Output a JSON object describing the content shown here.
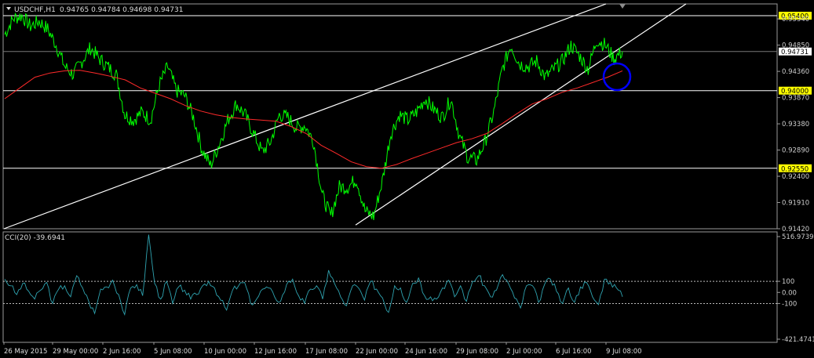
{
  "header": {
    "symbol": "USDCHF,H1",
    "ohlc": "0.94765 0.94784 0.94698 0.94731"
  },
  "indicator": {
    "label": "CCI(20) -39.6941"
  },
  "colors": {
    "background": "#000000",
    "price": "#00ff00",
    "ma": "#ff2a2a",
    "cci": "#2fa3b0",
    "hline": "#ffffff",
    "level_label_bg": "#ffff00",
    "marker": "#0000ff"
  },
  "chart_data": [
    {
      "type": "line",
      "title": "USDCHF,H1",
      "y_ticks": [
        "0.95340",
        "0.94850",
        "0.94360",
        "0.93870",
        "0.93380",
        "0.92890",
        "0.92400",
        "0.91910",
        "0.91420"
      ],
      "ylim": [
        0.9142,
        0.9562
      ],
      "current_price": "0.94731",
      "horizontal_levels": [
        {
          "value": 0.954,
          "label": "0.95400"
        },
        {
          "value": 0.94,
          "label": "0.94000"
        },
        {
          "value": 0.9255,
          "label": "0.92550"
        }
      ],
      "x_ticks": [
        "26 May 2015",
        "29 May 00:00",
        "2 Jun 16:00",
        "5 Jun 08:00",
        "10 Jun 00:00",
        "12 Jun 16:00",
        "17 Jun 08:00",
        "22 Jun 00:00",
        "24 Jun 16:00",
        "29 Jun 08:00",
        "2 Jul 00:00",
        "6 Jul 16:00",
        "9 Jul 08:00"
      ],
      "series": [
        {
          "role": "price",
          "color": "#00ff00",
          "values": [
            0.9505,
            0.9535,
            0.954,
            0.952,
            0.953,
            0.9515,
            0.9485,
            0.9445,
            0.943,
            0.9455,
            0.948,
            0.946,
            0.9445,
            0.943,
            0.9355,
            0.9345,
            0.936,
            0.9345,
            0.941,
            0.9445,
            0.94,
            0.939,
            0.935,
            0.929,
            0.926,
            0.93,
            0.9345,
            0.9375,
            0.9355,
            0.932,
            0.9285,
            0.9305,
            0.9355,
            0.935,
            0.933,
            0.9335,
            0.9305,
            0.9205,
            0.9165,
            0.922,
            0.922,
            0.9235,
            0.9175,
            0.9165,
            0.923,
            0.932,
            0.9355,
            0.9345,
            0.936,
            0.9385,
            0.9365,
            0.935,
            0.9385,
            0.9315,
            0.9275,
            0.927,
            0.9305,
            0.936,
            0.944,
            0.9485,
            0.945,
            0.9445,
            0.9455,
            0.9425,
            0.944,
            0.9455,
            0.9485,
            0.9465,
            0.944,
            0.9495,
            0.9485,
            0.946,
            0.9473
          ]
        },
        {
          "role": "moving-average",
          "color": "#ff2a2a",
          "values": [
            0.9385,
            0.9405,
            0.9425,
            0.9433,
            0.9437,
            0.9438,
            0.9433,
            0.9427,
            0.942,
            0.9405,
            0.9395,
            0.9385,
            0.9372,
            0.9362,
            0.9355,
            0.935,
            0.9347,
            0.9345,
            0.9343,
            0.9333,
            0.932,
            0.9298,
            0.9283,
            0.9267,
            0.9258,
            0.9255,
            0.9262,
            0.9273,
            0.9283,
            0.9293,
            0.9303,
            0.931,
            0.932,
            0.9338,
            0.9357,
            0.9375,
            0.9385,
            0.9397,
            0.9405,
            0.9415,
            0.9425,
            0.9437
          ]
        }
      ],
      "channels": [
        {
          "kind": "upper",
          "from": [
            "26 May 2015",
            0.9142
          ],
          "to": [
            "9 Jul 08:00",
            0.9562
          ]
        },
        {
          "kind": "lower",
          "from": [
            "22 Jun 00:00",
            0.9149
          ],
          "to": [
            "9 Jul 08:00",
            0.9462
          ]
        }
      ]
    },
    {
      "type": "line",
      "title": "CCI(20) -39.6941",
      "y_ticks": [
        "516.9739",
        "100",
        "0.00",
        "-100",
        "-421.4741"
      ],
      "ylim": [
        -421.4741,
        516.9739
      ],
      "reference_levels": [
        100,
        -100
      ],
      "series": [
        {
          "role": "cci",
          "color": "#2fa3b0",
          "values": [
            120,
            60,
            -20,
            80,
            10,
            -60,
            20,
            90,
            -100,
            30,
            60,
            -40,
            150,
            40,
            -80,
            -190,
            30,
            50,
            110,
            -20,
            -200,
            40,
            70,
            -30,
            520,
            80,
            -60,
            100,
            -100,
            50,
            20,
            -60,
            -20,
            60,
            100,
            40,
            -70,
            -160,
            20,
            60,
            90,
            -100,
            -60,
            30,
            40,
            -40,
            -80,
            70,
            120,
            -30,
            -100,
            30,
            60,
            -60,
            200,
            80,
            -40,
            -120,
            60,
            40,
            -70,
            100,
            30,
            -50,
            -180,
            60,
            40,
            -90,
            80,
            130,
            -30,
            -40,
            -60,
            40,
            110,
            -40,
            60,
            -80,
            100,
            150,
            60,
            -40,
            20,
            160,
            80,
            -50,
            -140,
            60,
            60,
            -90,
            70,
            120,
            10,
            -100,
            40,
            -90,
            50,
            90,
            -40,
            -110,
            120,
            90,
            40,
            -40
          ]
        }
      ]
    }
  ]
}
